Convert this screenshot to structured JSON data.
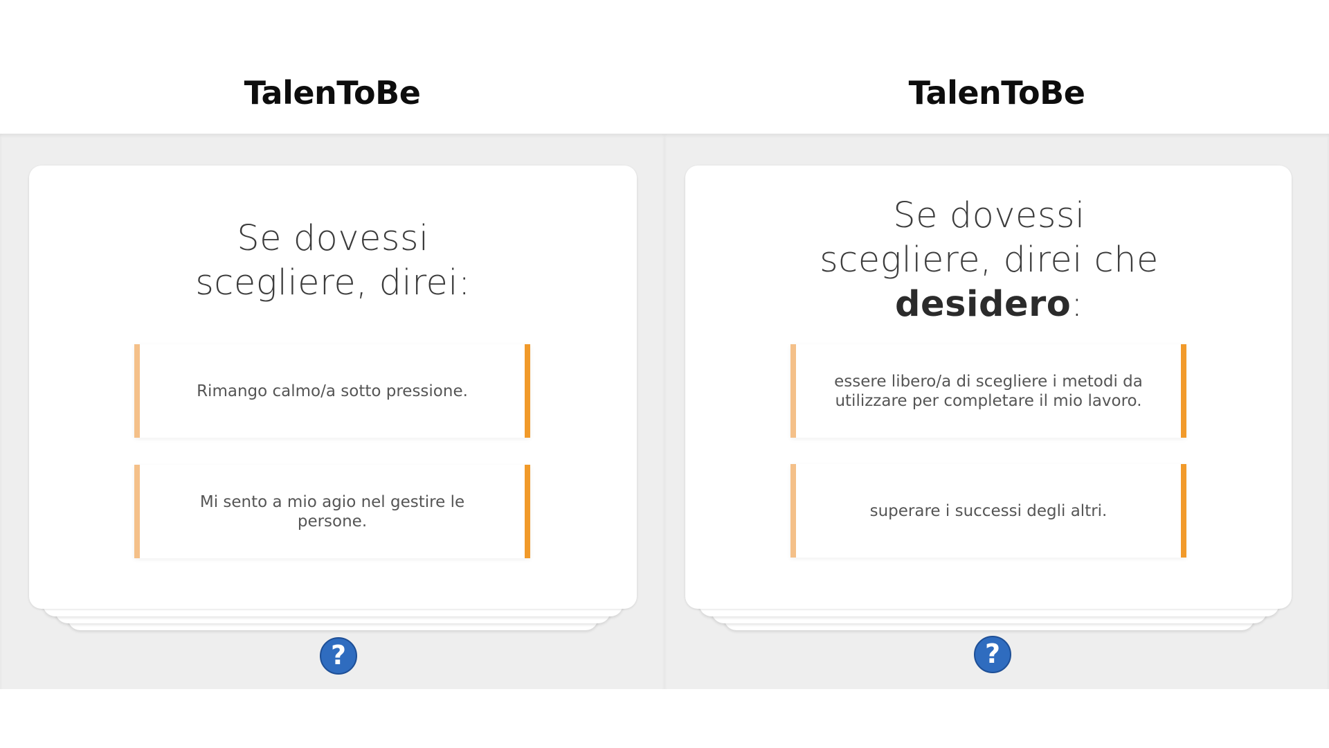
{
  "colors": {
    "answer_border_left": "#f4c089",
    "answer_border_right": "#f19a2a",
    "help_button": "#2f6cbf",
    "page_background": "#eeeeee"
  },
  "left_panel": {
    "app_title": "TalenToBe",
    "question": {
      "line1": "Se dovessi",
      "line2": "scegliere, direi:"
    },
    "answers": [
      "Rimango calmo/a sotto pressione.",
      "Mi sento a mio agio nel gestire le persone."
    ],
    "help_icon": "question-mark-icon",
    "help_label": "?"
  },
  "right_panel": {
    "app_title": "TalenToBe",
    "question": {
      "line1": "Se dovessi",
      "line2": "scegliere, direi che",
      "emphasis": "desidero",
      "suffix": ":"
    },
    "answers": [
      "essere libero/a di scegliere i metodi da utilizzare per completare il mio lavoro.",
      "superare i successi degli altri."
    ],
    "help_icon": "question-mark-icon",
    "help_label": "?"
  }
}
